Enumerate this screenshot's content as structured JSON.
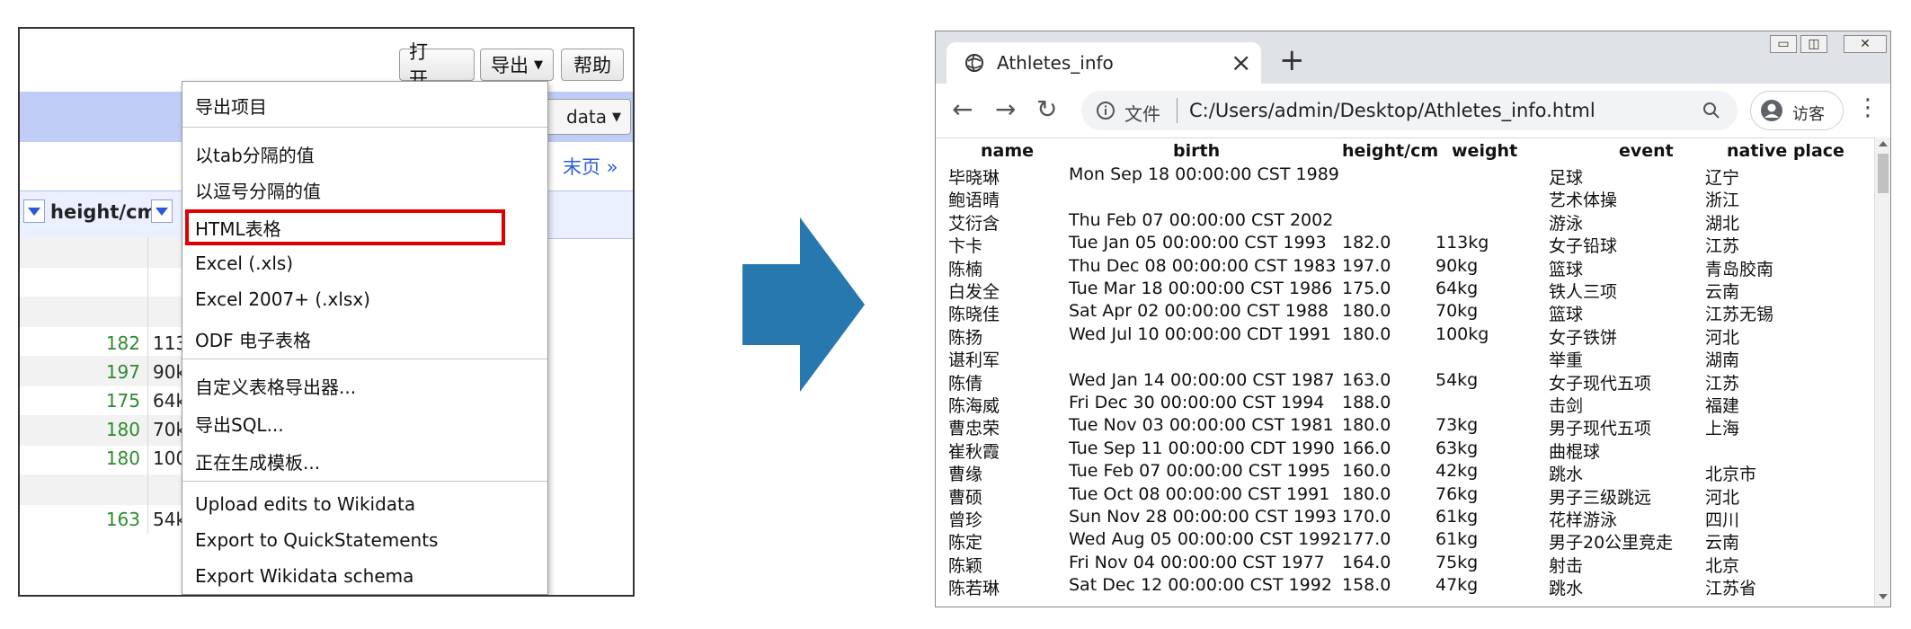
{
  "left": {
    "buttons": {
      "open": "打开...",
      "export": "导出",
      "help": "帮助"
    },
    "data_button": "data",
    "last_page_link": "末页 »",
    "column_header": "height/cm",
    "rows": [
      {
        "height": "182",
        "weight": "113"
      },
      {
        "height": "197",
        "weight": "90k"
      },
      {
        "height": "175",
        "weight": "64k"
      },
      {
        "height": "180",
        "weight": "70k"
      },
      {
        "height": "180",
        "weight": "100"
      },
      {
        "height": "163",
        "weight": "54k"
      }
    ],
    "menu": [
      "导出项目",
      "以tab分隔的值",
      "以逗号分隔的值",
      "HTML表格",
      "Excel (.xls)",
      "Excel 2007+ (.xlsx)",
      "ODF 电子表格",
      "自定义表格导出器...",
      "导出SQL...",
      "正在生成模板...",
      "Upload edits to Wikidata",
      "Export to QuickStatements",
      "Export Wikidata schema"
    ],
    "highlighted_item": "HTML表格",
    "highlight_color": "#e00000"
  },
  "arrow_color": "#2878b0",
  "browser": {
    "tab_title": "Athletes_info",
    "url_prefix": "文件",
    "url": "C:/Users/admin/Desktop/Athletes_info.html",
    "guest_label": "访客",
    "table": {
      "headers": [
        "name",
        "birth",
        "height/cm",
        "weight",
        "event",
        "native place"
      ],
      "rows": [
        [
          "毕晓琳",
          "Mon Sep 18 00:00:00 CST 1989",
          "",
          "",
          "足球",
          "辽宁"
        ],
        [
          "鲍语晴",
          "",
          "",
          "",
          "艺术体操",
          "浙江"
        ],
        [
          "艾衍含",
          "Thu Feb 07 00:00:00 CST 2002",
          "",
          "",
          "游泳",
          "湖北"
        ],
        [
          "卞卡",
          "Tue Jan 05 00:00:00 CST 1993",
          "182.0",
          "113kg",
          "女子铅球",
          "江苏"
        ],
        [
          "陈楠",
          "Thu Dec 08 00:00:00 CST 1983",
          "197.0",
          "90kg",
          "篮球",
          "青岛胶南"
        ],
        [
          "白发全",
          "Tue Mar 18 00:00:00 CST 1986",
          "175.0",
          "64kg",
          "铁人三项",
          "云南"
        ],
        [
          "陈晓佳",
          "Sat Apr 02 00:00:00 CST 1988",
          "180.0",
          "70kg",
          "篮球",
          "江苏无锡"
        ],
        [
          "陈扬",
          "Wed Jul 10 00:00:00 CDT 1991",
          "180.0",
          "100kg",
          "女子铁饼",
          "河北"
        ],
        [
          "谌利军",
          "",
          "",
          "",
          "举重",
          "湖南"
        ],
        [
          "陈倩",
          "Wed Jan 14 00:00:00 CST 1987",
          "163.0",
          "54kg",
          "女子现代五项",
          "江苏"
        ],
        [
          "陈海威",
          "Fri Dec 30 00:00:00 CST 1994",
          "188.0",
          "",
          "击剑",
          "福建"
        ],
        [
          "曹忠荣",
          "Tue Nov 03 00:00:00 CST 1981",
          "180.0",
          "73kg",
          "男子现代五项",
          "上海"
        ],
        [
          "崔秋霞",
          "Tue Sep 11 00:00:00 CDT 1990",
          "166.0",
          "63kg",
          "曲棍球",
          ""
        ],
        [
          "曹缘",
          "Tue Feb 07 00:00:00 CST 1995",
          "160.0",
          "42kg",
          "跳水",
          "北京市"
        ],
        [
          "曹硕",
          "Tue Oct 08 00:00:00 CST 1991",
          "180.0",
          "76kg",
          "男子三级跳远",
          "河北"
        ],
        [
          "曾珍",
          "Sun Nov 28 00:00:00 CST 1993",
          "170.0",
          "61kg",
          "花样游泳",
          "四川"
        ],
        [
          "陈定",
          "Wed Aug 05 00:00:00 CST 1992",
          "177.0",
          "61kg",
          "男子20公里竞走",
          "云南"
        ],
        [
          "陈颖",
          "Fri Nov 04 00:00:00 CST 1977",
          "164.0",
          "75kg",
          "射击",
          "北京"
        ],
        [
          "陈若琳",
          "Sat Dec 12 00:00:00 CST 1992",
          "158.0",
          "47kg",
          "跳水",
          "江苏省"
        ]
      ]
    }
  }
}
